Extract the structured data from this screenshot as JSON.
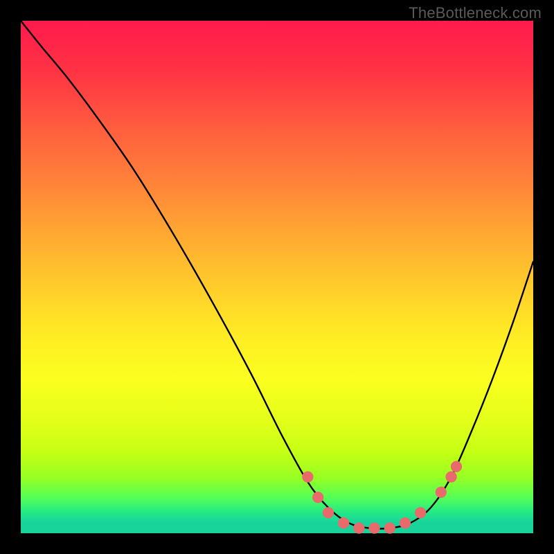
{
  "watermark": "TheBottleneck.com",
  "chart_data": {
    "type": "line",
    "title": "",
    "xlabel": "",
    "ylabel": "",
    "xlim": [
      0,
      100
    ],
    "ylim": [
      0,
      100
    ],
    "grid": false,
    "series": [
      {
        "name": "bottleneck-curve",
        "color": "#000000",
        "x": [
          0,
          4,
          9,
          15,
          22,
          30,
          38,
          45,
          51,
          56,
          60,
          64,
          68,
          72,
          76,
          80,
          84,
          88,
          92,
          96,
          100
        ],
        "y": [
          100,
          95,
          89,
          81,
          71,
          58,
          44,
          31,
          19,
          10,
          5,
          2,
          1,
          1,
          2,
          5,
          11,
          20,
          30,
          41,
          53
        ]
      }
    ],
    "markers": {
      "name": "highlight-points",
      "color": "#e96a6a",
      "radius_pct": 1.1,
      "points": [
        {
          "x": 56,
          "y": 11
        },
        {
          "x": 58,
          "y": 7
        },
        {
          "x": 60,
          "y": 4
        },
        {
          "x": 63,
          "y": 2
        },
        {
          "x": 66,
          "y": 1
        },
        {
          "x": 69,
          "y": 1
        },
        {
          "x": 72,
          "y": 1
        },
        {
          "x": 75,
          "y": 2
        },
        {
          "x": 78,
          "y": 4
        },
        {
          "x": 82,
          "y": 8
        },
        {
          "x": 84,
          "y": 11
        },
        {
          "x": 85,
          "y": 13
        }
      ]
    },
    "gradient_stops": [
      {
        "pos": 0,
        "color": "#ff1a4d"
      },
      {
        "pos": 50,
        "color": "#ffc62c"
      },
      {
        "pos": 80,
        "color": "#e3ff19"
      },
      {
        "pos": 100,
        "color": "#18d39a"
      }
    ]
  }
}
